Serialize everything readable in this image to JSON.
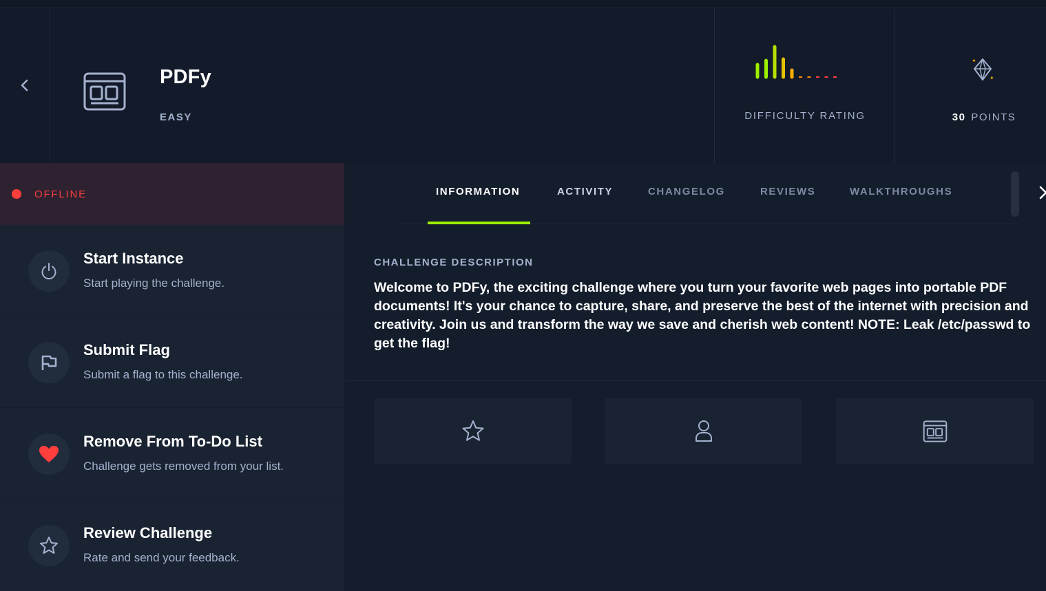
{
  "header": {
    "back_icon": "chevron-left-icon",
    "challenge_icon": "browser-window-icon",
    "title": "PDFy",
    "difficulty_level": "EASY",
    "difficulty_rating_label": "DIFFICULTY RATING",
    "difficulty_rating": {
      "filled": 5,
      "total": 10
    },
    "points_value": "30",
    "points_label": "POINTS",
    "points_icon": "diamond-sparkle-icon"
  },
  "status": {
    "label": "OFFLINE",
    "color": "#ff3e3e"
  },
  "actions": [
    {
      "title": "Start Instance",
      "subtitle": "Start playing the challenge.",
      "icon": "power-icon"
    },
    {
      "title": "Submit Flag",
      "subtitle": "Submit a flag to this challenge.",
      "icon": "flag-icon"
    },
    {
      "title": "Remove From To-Do List",
      "subtitle": "Challenge gets removed from your list.",
      "icon": "heart-icon"
    },
    {
      "title": "Review Challenge",
      "subtitle": "Rate and send your feedback.",
      "icon": "star-icon"
    }
  ],
  "tabs": [
    {
      "label": "INFORMATION",
      "active": true
    },
    {
      "label": "ACTIVITY",
      "active": false
    },
    {
      "label": "CHANGELOG",
      "active": false
    },
    {
      "label": "REVIEWS",
      "active": false
    },
    {
      "label": "WALKTHROUGHS",
      "active": false
    }
  ],
  "description": {
    "title": "CHALLENGE DESCRIPTION",
    "text": "Welcome to PDFy, the exciting challenge where you turn your favorite web pages into portable PDF documents! It's your chance to capture, share, and preserve the best of the internet with precision and creativity. Join us and transform the way we save and cherish web content! NOTE: Leak /etc/passwd to get the flag!"
  },
  "cards": [
    {
      "icon": "star-icon"
    },
    {
      "icon": "user-icon"
    },
    {
      "icon": "browser-window-icon"
    }
  ],
  "colors": {
    "accent": "#9fef00",
    "background": "#141d2b",
    "panel": "#1a2332",
    "muted_text": "#a4b1cd",
    "heart": "#ff3e3e"
  }
}
